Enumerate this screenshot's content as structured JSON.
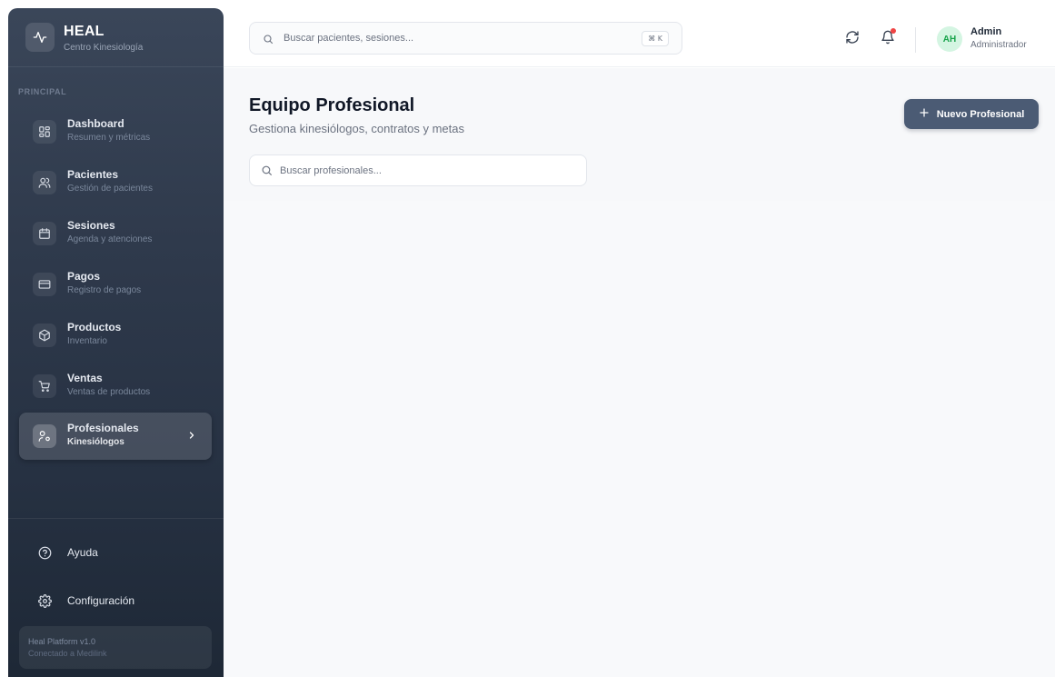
{
  "brand": {
    "name": "HEAL",
    "subtitle": "Centro Kinesiología"
  },
  "sidebar": {
    "section_label": "PRINCIPAL",
    "items": [
      {
        "label": "Dashboard",
        "sub": "Resumen y métricas",
        "icon": "dashboard-icon"
      },
      {
        "label": "Pacientes",
        "sub": "Gestión de pacientes",
        "icon": "users-icon"
      },
      {
        "label": "Sesiones",
        "sub": "Agenda y atenciones",
        "icon": "calendar-icon"
      },
      {
        "label": "Pagos",
        "sub": "Registro de pagos",
        "icon": "credit-card-icon"
      },
      {
        "label": "Productos",
        "sub": "Inventario",
        "icon": "package-icon"
      },
      {
        "label": "Ventas",
        "sub": "Ventas de productos",
        "icon": "cart-icon"
      },
      {
        "label": "Profesionales",
        "sub": "Kinesiólogos",
        "icon": "user-cog-icon",
        "active": true
      }
    ],
    "bottom_items": [
      {
        "label": "Ayuda",
        "icon": "help-circle-icon"
      },
      {
        "label": "Configuración",
        "icon": "gear-icon"
      }
    ],
    "platform": {
      "version": "Heal Platform v1.0",
      "status": "Conectado a Medilink"
    }
  },
  "topbar": {
    "search_placeholder": "Buscar pacientes, sesiones...",
    "shortcut": "⌘ K",
    "user": {
      "initials": "AH",
      "name": "Admin",
      "role": "Administrador"
    }
  },
  "main": {
    "title": "Equipo Profesional",
    "subtitle": "Gestiona kinesiólogos, contratos y metas",
    "new_button_label": "Nuevo Profesional",
    "search_placeholder": "Buscar profesionales..."
  },
  "colors": {
    "sidebar_top": "#3a4659",
    "sidebar_bottom": "#1e2836",
    "primary_button": "#4b5b74",
    "avatar_bg": "#d4f5e2",
    "avatar_text": "#16a34a",
    "notification_dot": "#ef4444"
  }
}
